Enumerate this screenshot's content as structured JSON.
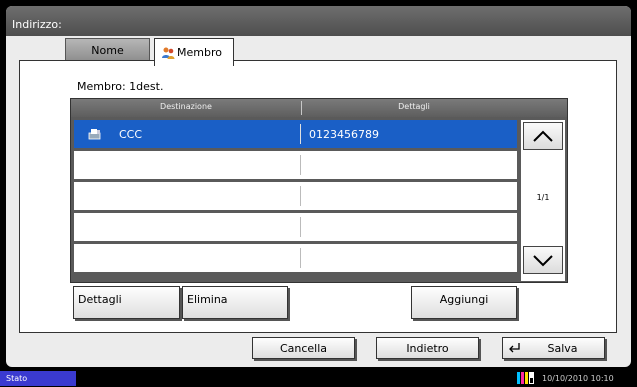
{
  "header": {
    "title": "Indirizzo:"
  },
  "tabs": [
    {
      "label": "Nome",
      "active": false
    },
    {
      "label": "Membro",
      "active": true
    }
  ],
  "member_count": "Membro: 1dest.",
  "table": {
    "columns": [
      "Destinazione",
      "Dettagli"
    ],
    "rows": [
      {
        "name": "CCC",
        "detail": "0123456789",
        "icon": "fax-icon",
        "selected": true
      },
      {
        "name": "",
        "detail": "",
        "selected": false
      },
      {
        "name": "",
        "detail": "",
        "selected": false
      },
      {
        "name": "",
        "detail": "",
        "selected": false
      },
      {
        "name": "",
        "detail": "",
        "selected": false
      }
    ],
    "page_indicator": "1/1"
  },
  "actions": {
    "details": "Dettagli",
    "delete": "Elimina",
    "add": "Aggiungi"
  },
  "footer": {
    "cancel": "Cancella",
    "back": "Indietro",
    "save": "Salva"
  },
  "status": {
    "label": "Stato",
    "datetime": "10/10/2010  10:10"
  },
  "colors": {
    "selected_row": "#1a5fc6",
    "status_bg": "#3a3ad0"
  }
}
